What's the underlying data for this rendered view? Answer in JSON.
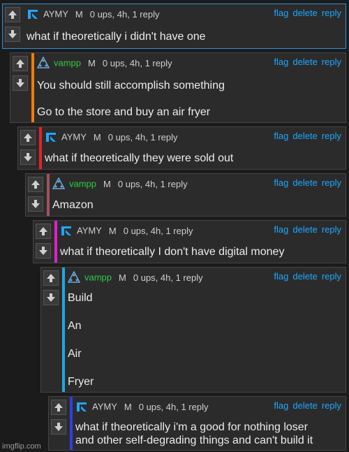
{
  "comments": [
    {
      "user": "AYMY",
      "mod": "M",
      "stats": "0 ups, 4h, 1 reply",
      "text": [
        "what if theoretically i didn't have one"
      ],
      "bar_color": "",
      "user_color": "#cfcfcf"
    },
    {
      "user": "vampp",
      "mod": "M",
      "stats": "0 ups, 4h, 1 reply",
      "text": [
        "You should still accomplish something",
        "Go to the store and buy an air fryer"
      ],
      "bar_color": "#f57c00",
      "user_color": "#2ecc40"
    },
    {
      "user": "AYMY",
      "mod": "M",
      "stats": "0 ups, 4h, 1 reply",
      "text": [
        "what if theoretically they were sold out"
      ],
      "bar_color": "#e8202a",
      "user_color": "#cfcfcf"
    },
    {
      "user": "vampp",
      "mod": "M",
      "stats": "0 ups, 4h, 1 reply",
      "text": [
        "Amazon"
      ],
      "bar_color": "#a0525c",
      "user_color": "#2ecc40"
    },
    {
      "user": "AYMY",
      "mod": "M",
      "stats": "0 ups, 4h, 1 reply",
      "text": [
        "what if theoretically I don't have digital money"
      ],
      "bar_color": "#e020c8",
      "user_color": "#cfcfcf"
    },
    {
      "user": "vampp",
      "mod": "M",
      "stats": "0 ups, 4h, 1 reply",
      "text": [
        "Build",
        "An",
        "Air",
        "Fryer"
      ],
      "bar_color": "#1fa8e0",
      "user_color": "#2ecc40"
    },
    {
      "user": "AYMY",
      "mod": "M",
      "stats": "0 ups, 4h, 1 reply",
      "text": [
        "what if theoretically i'm a good for nothing loser",
        "and other self-degrading things and can't build it"
      ],
      "bar_color": "#2f3fe0",
      "user_color": "#cfcfcf"
    }
  ],
  "actions": {
    "flag": "flag",
    "delete": "delete",
    "reply": "reply"
  },
  "watermark": "imgflip.com"
}
